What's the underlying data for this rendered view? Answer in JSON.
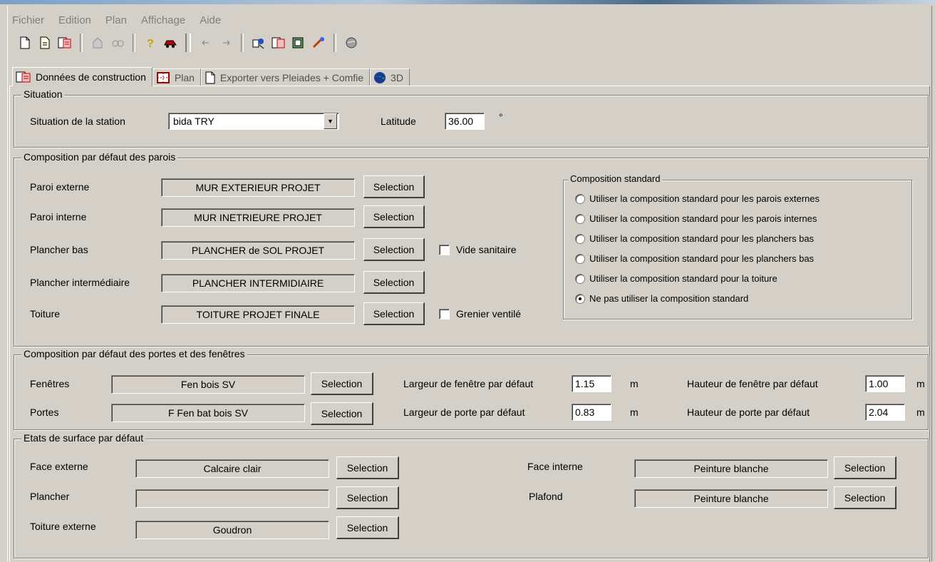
{
  "menu": [
    "Fichier",
    "Edition",
    "Plan",
    "Affichage",
    "Aide"
  ],
  "tabs": [
    {
      "label": "Données de construction"
    },
    {
      "label": "Plan"
    },
    {
      "label": "Exporter vers Pleiades + Comfie"
    },
    {
      "label": "3D"
    }
  ],
  "situation": {
    "title": "Situation",
    "station_label": "Situation de la station",
    "station_value": "bida TRY",
    "latitude_label": "Latitude",
    "latitude_value": "36.00",
    "latitude_unit": "°"
  },
  "walls": {
    "title": "Composition par défaut des parois",
    "select_label": "Selection",
    "rows": [
      {
        "label": "Paroi externe",
        "value": "MUR EXTERIEUR PROJET"
      },
      {
        "label": "Paroi interne",
        "value": "MUR INETRIEURE PROJET"
      },
      {
        "label": "Plancher bas",
        "value": "PLANCHER de SOL PROJET"
      },
      {
        "label": "Plancher intermédiaire",
        "value": "PLANCHER INTERMIDIAIRE"
      },
      {
        "label": "Toiture",
        "value": "TOITURE PROJET FINALE"
      }
    ],
    "vide_sanitaire": "Vide sanitaire",
    "grenier_ventile": "Grenier ventilé",
    "standard": {
      "title": "Composition standard",
      "options": [
        "Utiliser la composition standard pour les parois externes",
        "Utiliser la composition standard pour les parois internes",
        "Utiliser la composition standard pour les planchers bas",
        "Utiliser la composition standard pour les planchers bas",
        "Utiliser la composition standard pour la toiture",
        "Ne pas utiliser la composition standard"
      ],
      "selected_index": 5
    }
  },
  "openings": {
    "title": "Composition par défaut des portes et des fenêtres",
    "windows_label": "Fenêtres",
    "windows_value": "Fen bois SV",
    "doors_label": "Portes",
    "doors_value": "F Fen bat bois SV",
    "select_label": "Selection",
    "win_width_label": "Largeur de fenêtre par défaut",
    "win_width_value": "1.15",
    "win_height_label": "Hauteur de fenêtre par défaut",
    "win_height_value": "1.00",
    "door_width_label": "Largeur de porte par défaut",
    "door_width_value": "0.83",
    "door_height_label": "Hauteur de porte par défaut",
    "door_height_value": "2.04",
    "unit": "m"
  },
  "surfaces": {
    "title": "Etats de surface par défaut",
    "select_label": "Selection",
    "ext_face_label": "Face externe",
    "ext_face_value": "Calcaire clair",
    "floor_label": "Plancher",
    "floor_value": "",
    "roof_label": "Toiture externe",
    "roof_value": "Goudron",
    "int_face_label": "Face interne",
    "int_face_value": "Peinture blanche",
    "ceiling_label": "Plafond",
    "ceiling_value": "Peinture blanche"
  }
}
